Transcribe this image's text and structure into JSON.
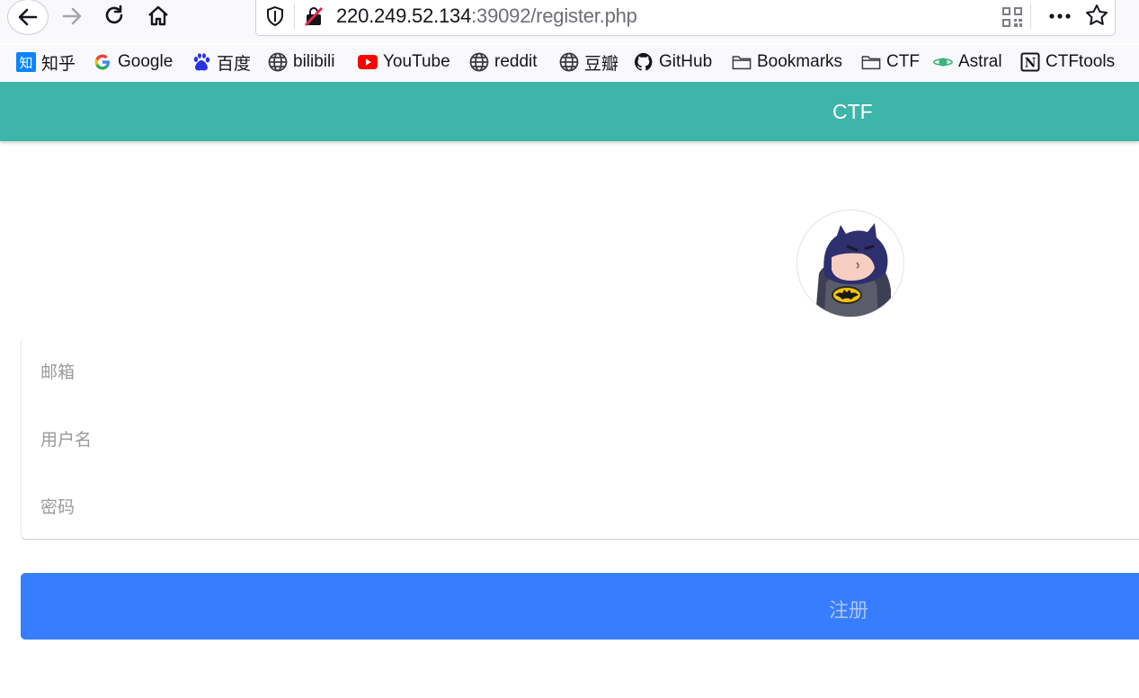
{
  "browser": {
    "url_host": "220.249.52.134",
    "url_rest": ":39092/register.php"
  },
  "bookmarks": [
    {
      "label": "知乎",
      "icon": "zhihu-icon"
    },
    {
      "label": "Google",
      "icon": "google-icon"
    },
    {
      "label": "百度",
      "icon": "baidu-icon"
    },
    {
      "label": "bilibili",
      "icon": "globe-icon"
    },
    {
      "label": "YouTube",
      "icon": "youtube-icon"
    },
    {
      "label": "reddit",
      "icon": "globe-icon"
    },
    {
      "label": "豆瓣",
      "icon": "globe-icon"
    },
    {
      "label": "GitHub",
      "icon": "github-icon"
    },
    {
      "label": "Bookmarks",
      "icon": "folder-icon"
    },
    {
      "label": "CTF",
      "icon": "folder-icon"
    },
    {
      "label": "Astral",
      "icon": "planet-icon"
    },
    {
      "label": "CTFtools",
      "icon": "notion-icon"
    }
  ],
  "header": {
    "title": "CTF"
  },
  "form": {
    "email_placeholder": "邮箱",
    "username_placeholder": "用户名",
    "password_placeholder": "密码",
    "submit_label": "注册"
  },
  "colors": {
    "header_bg": "#3db5a8",
    "button_bg": "#377dff",
    "button_text": "#a9c4f5"
  }
}
